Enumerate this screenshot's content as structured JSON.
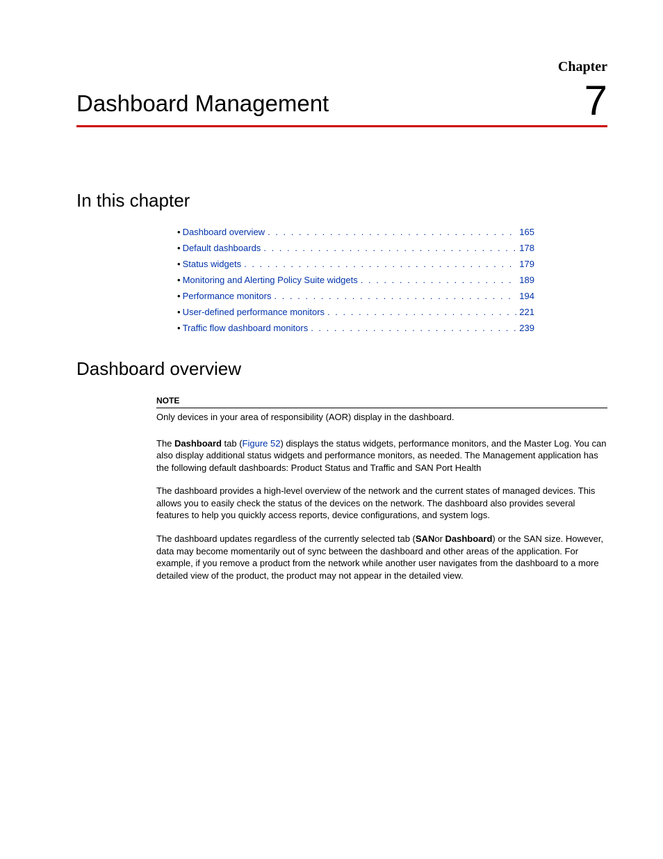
{
  "chapter": {
    "label": "Chapter",
    "number": "7",
    "title": "Dashboard Management"
  },
  "sections": {
    "in_this_chapter": "In this chapter",
    "dashboard_overview": "Dashboard overview"
  },
  "toc": [
    {
      "label": "Dashboard overview",
      "page": "165"
    },
    {
      "label": "Default dashboards",
      "page": "178"
    },
    {
      "label": "Status widgets",
      "page": "179"
    },
    {
      "label": "Monitoring and Alerting Policy Suite widgets",
      "page": "189"
    },
    {
      "label": "Performance monitors",
      "page": "194"
    },
    {
      "label": "User-defined performance monitors",
      "page": "221"
    },
    {
      "label": "Traffic flow dashboard monitors",
      "page": "239"
    }
  ],
  "note": {
    "label": "NOTE",
    "text": "Only devices in your area of responsibility (AOR) display in the dashboard."
  },
  "para1": {
    "pre": "The ",
    "bold1": "Dashboard",
    "mid1": " tab (",
    "figref": "Figure 52",
    "post": ") displays the status widgets, performance monitors, and the Master Log. You can also display additional status widgets and performance monitors, as needed. The Management application has the following default dashboards: Product Status and Traffic and SAN Port Health"
  },
  "para2": "The dashboard provides a high-level overview of the network and the current states of managed devices. This allows you to easily check the status of the devices on the network. The dashboard also provides several features to help you quickly access reports, device configurations, and system logs.",
  "para3": {
    "pre": "The dashboard updates regardless of the currently selected tab (",
    "bold1": "SAN",
    "mid1": "or ",
    "bold2": "Dashboard",
    "post": ") or the SAN size. However, data may become momentarily out of sync between the dashboard and other areas of the application. For example, if you remove a product from the network while another user navigates from the dashboard to a more detailed view of the product, the product may not appear in the detailed view."
  },
  "dots": ". . . . . . . . . . . . . . . . . . . . . . . . . . . . . . . . . . . . . . . . . . . . . . . . . . . . . . . . . . . ."
}
